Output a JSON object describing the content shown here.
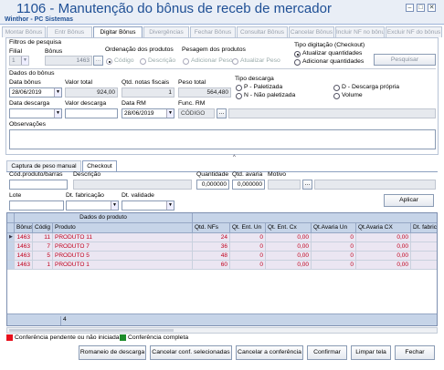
{
  "window": {
    "title": "1106 - Manutenção do bônus de receb de mercador",
    "subtitle": "Winthor - PC Sistemas"
  },
  "tabs": [
    "Montar Bônus",
    "Entr Bônus",
    "Digitar Bônus",
    "Divergências",
    "Fechar Bônus",
    "Consultar Bônus",
    "Cancelar Bônus",
    "Incluir NF no bônus",
    "Excluir NF do bônus"
  ],
  "filtros": {
    "group_label": "Filtros de pesquisa",
    "filial_label": "Filial",
    "filial_value": "1",
    "bonus_label": "Bônus",
    "bonus_value": "1463",
    "ordenacao_label": "Ordenação dos produtos",
    "ordenacao_codigo": "Código",
    "ordenacao_descricao": "Descrição",
    "pesagem_label": "Pesagem dos produtos",
    "pesagem_adicionar": "Adicionar Peso",
    "pesagem_atualizar": "Atualizar Peso",
    "tipo_label": "Tipo digitação (Checkout)",
    "tipo_atualizar": "Atualizar quantidades",
    "tipo_adicionar": "Adicionar quantidades",
    "pesquisar": "Pesquisar"
  },
  "dados": {
    "group_label": "Dados do bônus",
    "data_bonus_label": "Data bônus",
    "data_bonus": "28/06/2019",
    "valor_total_label": "Valor total",
    "valor_total": "924,00",
    "qtd_notas_label": "Qtd. notas fiscais",
    "qtd_notas": "1",
    "peso_total_label": "Peso total",
    "peso_total": "564,480",
    "data_descarga_label": "Data descarga",
    "data_descarga": "",
    "valor_descarga_label": "Valor descarga",
    "valor_descarga": "",
    "data_rm_label": "Data RM",
    "data_rm": "28/06/2019",
    "func_rm_label": "Func. RM",
    "func_rm_codigo": "CÓDIGO",
    "tipo_descarga_label": "Tipo descarga",
    "tipo_p": "P - Paletizada",
    "tipo_n": "N - Não paletizada",
    "tipo_d": "D - Descarga própria",
    "tipo_v": "Volume",
    "observacoes_label": "Observações"
  },
  "subtabs": [
    "Captura de peso manual",
    "Checkout"
  ],
  "checkout": {
    "cod_label": "Cód.produto/barras",
    "descricao_label": "Descrição",
    "quantidade_label": "Quantidade",
    "quantidade": "0,000000",
    "qtd_avaria_label": "Qtd. avaria",
    "qtd_avaria": "0,000000",
    "motivo_label": "Motivo",
    "lote_label": "Lote",
    "dt_fabricacao_label": "Dt. fabricação",
    "dt_validade_label": "Dt. validade",
    "aplicar": "Aplicar"
  },
  "grid": {
    "group_header": "Dados do produto",
    "columns": [
      "Bônus",
      "Códig",
      "Produto",
      "Qtd. NFs",
      "Qt. Ent. Un",
      "Qt. Ent. Cx",
      "Qt.Avaria Un",
      "Qt.Avaria CX",
      "Dt. fabrica"
    ],
    "rows": [
      [
        "1463",
        "11",
        "PRODUTO 11",
        "24",
        "0",
        "0,00",
        "0",
        "0,00",
        ""
      ],
      [
        "1463",
        "7",
        "PRODUTO 7",
        "36",
        "0",
        "0,00",
        "0",
        "0,00",
        ""
      ],
      [
        "1463",
        "5",
        "PRODUTO 5",
        "48",
        "0",
        "0,00",
        "0",
        "0,00",
        ""
      ],
      [
        "1463",
        "1",
        "PRODUTO 1",
        "60",
        "0",
        "0,00",
        "0",
        "0,00",
        ""
      ]
    ],
    "footer_count": "4"
  },
  "legend": {
    "red_label": "Conferência pendente ou não iniciada",
    "green_label": "Conferência completa",
    "red_color": "#e8101c",
    "green_color": "#1c8c2a"
  },
  "buttons": [
    "Romaneio de descarga",
    "Cancelar conf. selecionadas",
    "Cancelar a conferência",
    "Confirmar",
    "Limpar tela",
    "Fechar"
  ]
}
